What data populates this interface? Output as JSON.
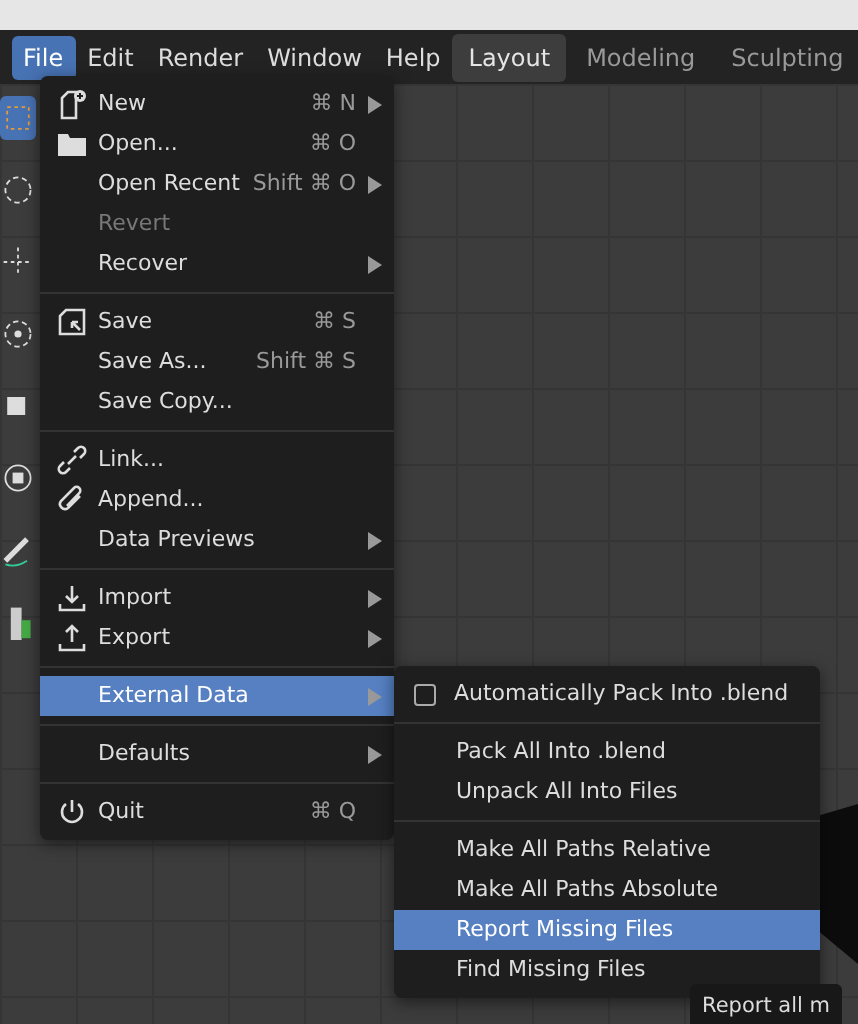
{
  "menubar": [
    {
      "label": "File",
      "selected": true
    },
    {
      "label": "Edit",
      "selected": false
    },
    {
      "label": "Render",
      "selected": false
    },
    {
      "label": "Window",
      "selected": false
    },
    {
      "label": "Help",
      "selected": false
    }
  ],
  "workspace_tabs": [
    {
      "label": "Layout",
      "selected": true
    },
    {
      "label": "Modeling",
      "selected": false
    },
    {
      "label": "Sculpting",
      "selected": false
    }
  ],
  "file_menu": [
    {
      "kind": "item",
      "label": "New",
      "shortcut": "⌘ N",
      "submenu": true,
      "disabled": false,
      "selected": false
    },
    {
      "kind": "item",
      "label": "Open...",
      "shortcut": "⌘ O",
      "submenu": false,
      "disabled": false,
      "selected": false
    },
    {
      "kind": "item",
      "label": "Open Recent",
      "shortcut": "Shift ⌘ O",
      "submenu": true,
      "disabled": false,
      "selected": false
    },
    {
      "kind": "item",
      "label": "Revert",
      "submenu": false,
      "disabled": true,
      "selected": false
    },
    {
      "kind": "item",
      "label": "Recover",
      "submenu": true,
      "disabled": false,
      "selected": false
    },
    {
      "kind": "separator"
    },
    {
      "kind": "item",
      "label": "Save",
      "shortcut": "⌘ S",
      "submenu": false,
      "disabled": false,
      "selected": false
    },
    {
      "kind": "item",
      "label": "Save As...",
      "shortcut": "Shift ⌘ S",
      "submenu": false,
      "disabled": false,
      "selected": false
    },
    {
      "kind": "item",
      "label": "Save Copy...",
      "submenu": false,
      "disabled": false,
      "selected": false
    },
    {
      "kind": "separator"
    },
    {
      "kind": "item",
      "label": "Link...",
      "submenu": false,
      "disabled": false,
      "selected": false
    },
    {
      "kind": "item",
      "label": "Append...",
      "submenu": false,
      "disabled": false,
      "selected": false
    },
    {
      "kind": "item",
      "label": "Data Previews",
      "submenu": true,
      "disabled": false,
      "selected": false
    },
    {
      "kind": "separator"
    },
    {
      "kind": "item",
      "label": "Import",
      "submenu": true,
      "disabled": false,
      "selected": false
    },
    {
      "kind": "item",
      "label": "Export",
      "submenu": true,
      "disabled": false,
      "selected": false
    },
    {
      "kind": "separator"
    },
    {
      "kind": "item",
      "label": "External Data",
      "submenu": true,
      "disabled": false,
      "selected": true
    },
    {
      "kind": "separator"
    },
    {
      "kind": "item",
      "label": "Defaults",
      "submenu": true,
      "disabled": false,
      "selected": false
    },
    {
      "kind": "separator"
    },
    {
      "kind": "item",
      "label": "Quit",
      "shortcut": "⌘ Q",
      "submenu": false,
      "disabled": false,
      "selected": false
    }
  ],
  "external_data_menu": [
    {
      "kind": "checkbox",
      "label": "Automatically Pack Into .blend",
      "checked": false,
      "selected": false
    },
    {
      "kind": "separator"
    },
    {
      "kind": "item",
      "label": "Pack All Into .blend",
      "selected": false
    },
    {
      "kind": "item",
      "label": "Unpack All Into Files",
      "selected": false
    },
    {
      "kind": "separator"
    },
    {
      "kind": "item",
      "label": "Make All Paths Relative",
      "selected": false
    },
    {
      "kind": "item",
      "label": "Make All Paths Absolute",
      "selected": false
    },
    {
      "kind": "item",
      "label": "Report Missing Files",
      "selected": true
    },
    {
      "kind": "item",
      "label": "Find Missing Files",
      "selected": false
    }
  ],
  "tooltip": "Report all m"
}
